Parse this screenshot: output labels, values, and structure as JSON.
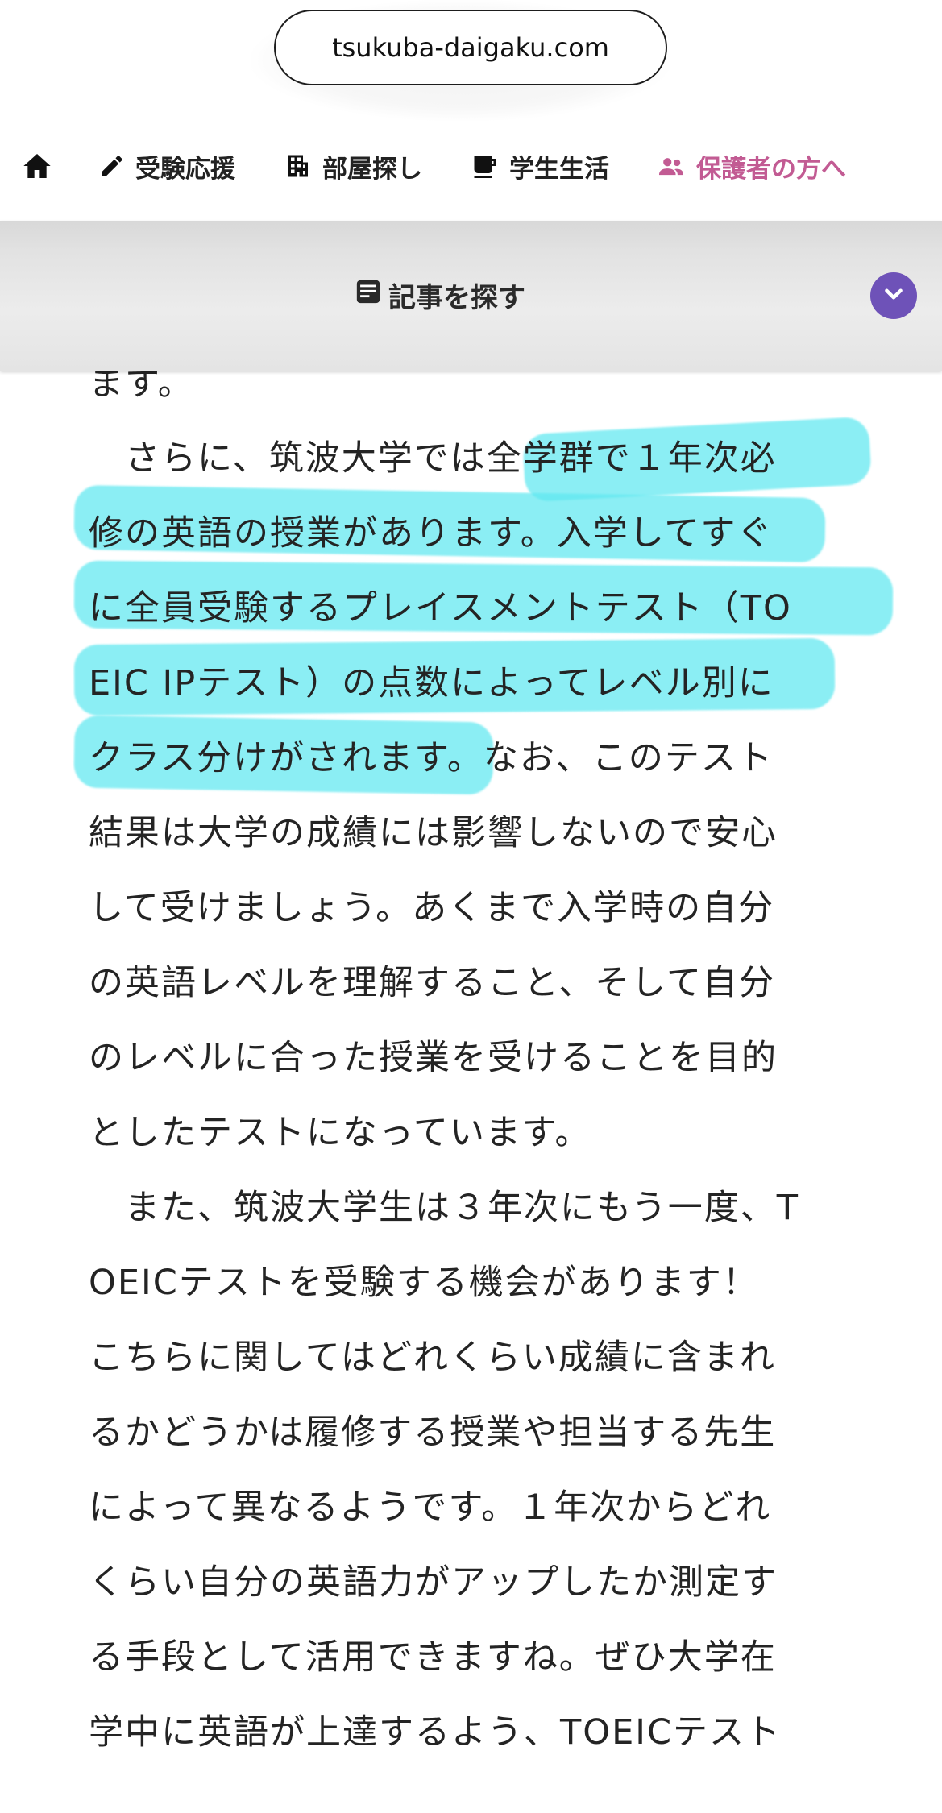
{
  "browser": {
    "url": "tsukuba-daigaku.com"
  },
  "nav": {
    "items": [
      {
        "icon": "home-icon",
        "label": ""
      },
      {
        "icon": "pencil-icon",
        "label": "受験応援"
      },
      {
        "icon": "building-icon",
        "label": "部屋探し"
      },
      {
        "icon": "cup-icon",
        "label": "学生生活"
      },
      {
        "icon": "people-icon",
        "label": "保護者の方へ"
      }
    ],
    "active_color": "#c25b93"
  },
  "search": {
    "icon": "article-search-icon",
    "label": "記事を探す",
    "toggle_icon": "chevron-down-icon",
    "accent": "#6e52b8"
  },
  "article": {
    "lines": [
      "ます。",
      "　さらに、筑波大学では全学群で１年次必",
      "修の英語の授業があります。入学してすぐ",
      "に全員受験するプレイスメントテスト（TO",
      "EIC IPテスト）の点数によってレベル別に",
      "クラス分けがされます。なお、このテスト",
      "結果は大学の成績には影響しないので安心",
      "して受けましょう。あくまで入学時の自分",
      "の英語レベルを理解すること、そして自分",
      "のレベルに合った授業を受けることを目的",
      "としたテストになっています。",
      "　また、筑波大学生は３年次にもう一度、T",
      "OEICテストを受験する機会があります！",
      "こちらに関してはどれくらい成績に含まれ",
      "るかどうかは履修する授業や担当する先生",
      "によって異なるようです。１年次からどれ",
      "くらい自分の英語力がアップしたか測定す",
      "る手段として活用できますね。ぜひ大学在",
      "学中に英語が上達するよう、TOEICテスト"
    ],
    "highlight_color": "#5fe8f0"
  }
}
